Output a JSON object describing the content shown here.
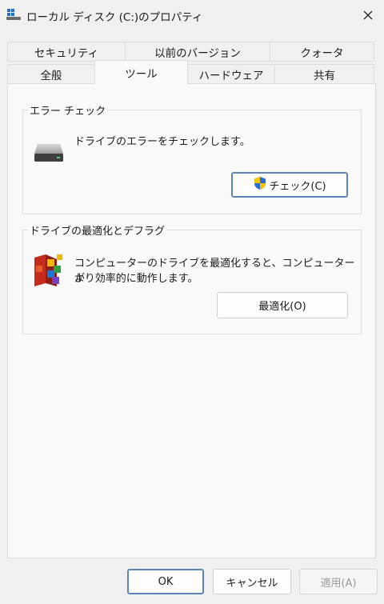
{
  "window": {
    "title": "ローカル ディスク (C:)のプロパティ"
  },
  "tabs": {
    "row1": [
      "セキュリティ",
      "以前のバージョン",
      "クォータ"
    ],
    "row2": [
      "全般",
      "ツール",
      "ハードウェア",
      "共有"
    ],
    "active": "ツール"
  },
  "error_check": {
    "group_label": "エラー チェック",
    "description": "ドライブのエラーをチェックします。",
    "button_label": "チェック(C)"
  },
  "optimize": {
    "group_label": "ドライブの最適化とデフラグ",
    "description_line1": "コンピューターのドライブを最適化すると、コンピューターが",
    "description_line2": "より効率的に動作します。",
    "button_label": "最適化(O)"
  },
  "footer": {
    "ok_label": "OK",
    "cancel_label": "キャンセル",
    "apply_label": "適用(A)"
  },
  "colors": {
    "accent": "#5b84b8",
    "shield_blue": "#2b6cd4",
    "shield_yellow": "#f5c400"
  }
}
